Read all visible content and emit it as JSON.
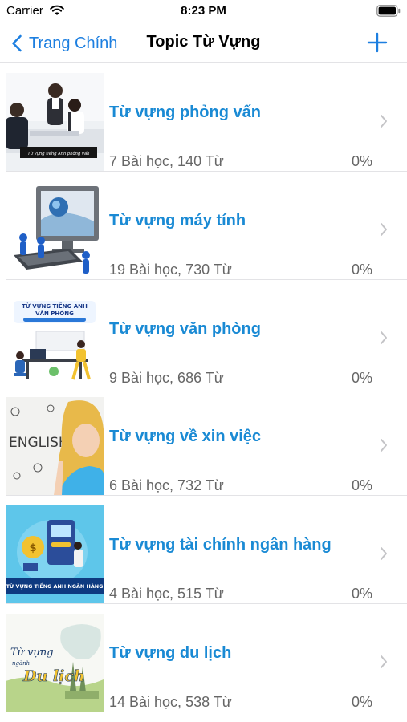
{
  "status_bar": {
    "carrier": "Carrier",
    "time": "8:23 PM"
  },
  "nav": {
    "back_label": "Trang Chính",
    "title": "Topic Từ Vựng"
  },
  "colors": {
    "accent": "#1d7fe0",
    "topic_title": "#1a8ad4",
    "meta_text": "#666666"
  },
  "topics": [
    {
      "title": "Từ vựng phỏng vấn",
      "meta": "7 Bài học, 140 Từ",
      "progress": "0%",
      "thumb": {
        "caption": "Từ vựng tiếng Anh phỏng vấn",
        "icon": "interview-photo"
      }
    },
    {
      "title": "Từ vựng máy tính",
      "meta": "19 Bài học, 730 Từ",
      "progress": "0%",
      "thumb": {
        "caption": "",
        "icon": "computer-figures-image"
      }
    },
    {
      "title": "Từ vựng văn phòng",
      "meta": "9 Bài học, 686 Từ",
      "progress": "0%",
      "thumb": {
        "caption": "TỪ VỰNG TIẾNG ANH",
        "caption2": "VĂN PHÒNG",
        "icon": "office-illustration"
      }
    },
    {
      "title": "Từ vựng về xin việc",
      "meta": "6 Bài học, 732 Từ",
      "progress": "0%",
      "thumb": {
        "caption": "ENGLISH",
        "icon": "english-girl-photo"
      }
    },
    {
      "title": "Từ vựng tài chính ngân hàng",
      "meta": "4 Bài học, 515 Từ",
      "progress": "0%",
      "thumb": {
        "caption": "TỪ VỰNG TIẾNG ANH NGÂN HÀNG",
        "icon": "banking-illustration"
      }
    },
    {
      "title": "Từ vựng du lịch",
      "meta": "14 Bài học, 538 Từ",
      "progress": "0%",
      "thumb": {
        "caption": "Từ vựng",
        "caption2": "ngành",
        "caption3": "Du lịch",
        "icon": "travel-image"
      }
    }
  ]
}
